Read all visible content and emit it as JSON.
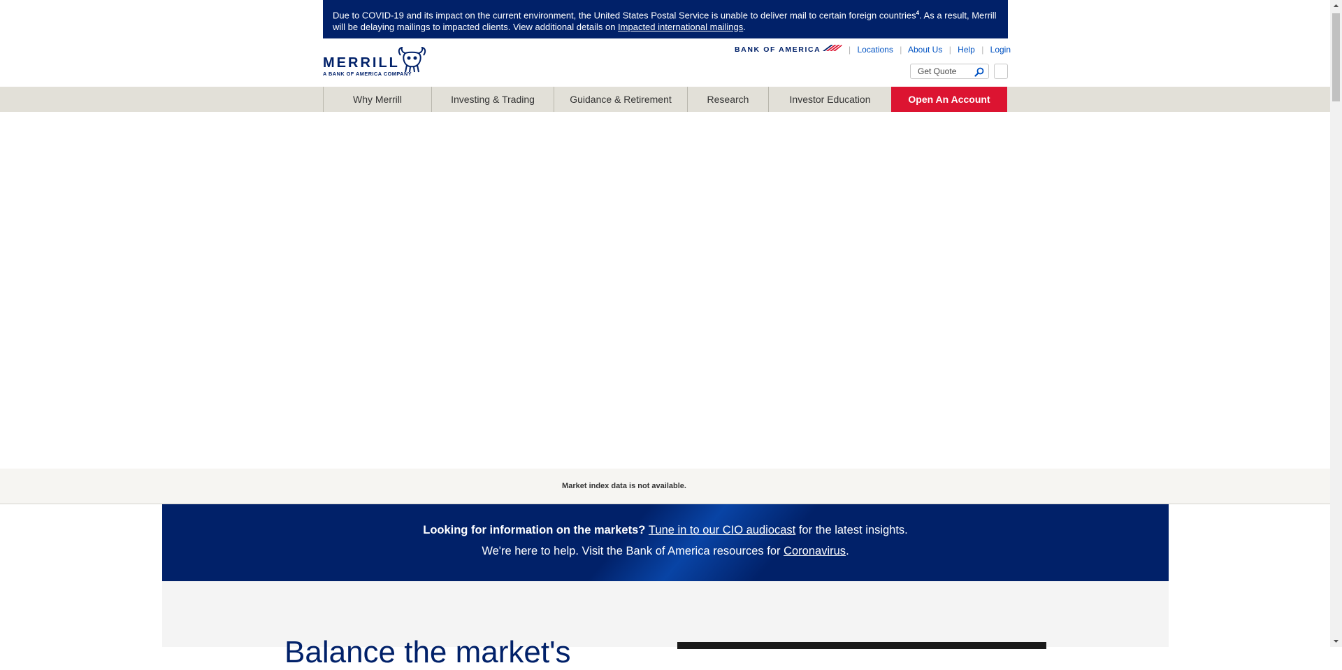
{
  "alert": {
    "text_1": "Due to COVID-19 and its impact on the current environment, the United States Postal Service is unable to deliver mail to certain foreign countries",
    "sup": "4",
    "text_2": ". As a result, Merrill will be delaying mailings to impacted clients. View additional details on ",
    "link": "Impacted international mailings",
    "text_3": "."
  },
  "header": {
    "logo_word": "MERRILL",
    "logo_sub": "A BANK OF AMERICA COMPANY",
    "boa_text": "BANK OF AMERICA",
    "utility_links": [
      "Locations",
      "About Us",
      "Help",
      "Login"
    ],
    "quote_placeholder": "Get Quote",
    "search_icon": "search-icon",
    "menu_icon": "menu-icon"
  },
  "nav": {
    "items": [
      "Why Merrill",
      "Investing & Trading",
      "Guidance & Retirement",
      "Research",
      "Investor Education"
    ],
    "cta": "Open An Account"
  },
  "market": {
    "message": "Market index data is not available."
  },
  "promo": {
    "line1_bold": "Looking for information on the markets?",
    "line1_link": "Tune in to our CIO audiocast",
    "line1_rest": " for the latest insights.",
    "line2_text": "We're here to help. Visit the Bank of America resources for ",
    "line2_link": "Coronavirus",
    "line2_end": "."
  },
  "hero": {
    "headline": "Balance the market's"
  },
  "colors": {
    "navy": "#012169",
    "red": "#dc1431",
    "link_blue": "#0052c2",
    "nav_bg": "#e2e0d8"
  }
}
